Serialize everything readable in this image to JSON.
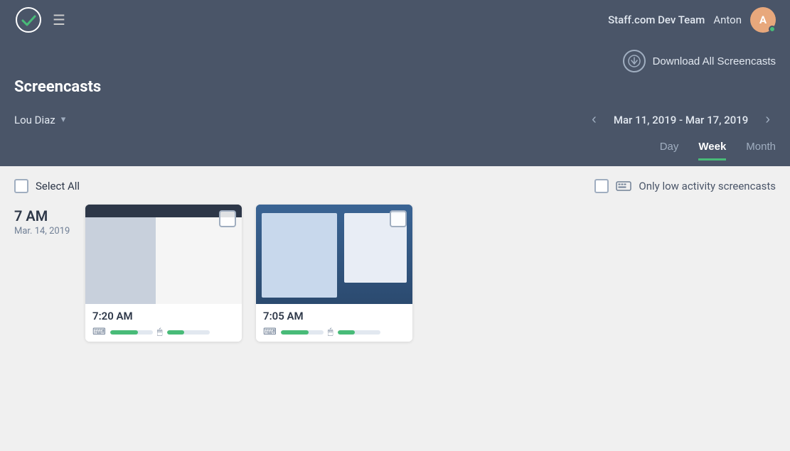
{
  "navbar": {
    "team": "Staff.com Dev Team",
    "user": "Anton",
    "avatar_initial": "A"
  },
  "header": {
    "download_label": "Download All Screencasts",
    "title": "Screencasts",
    "selected_user": "Lou Diaz",
    "date_range": "Mar 11, 2019 - Mar 17, 2019"
  },
  "view_tabs": [
    {
      "label": "Day",
      "active": false
    },
    {
      "label": "Week",
      "active": true
    },
    {
      "label": "Month",
      "active": false
    }
  ],
  "filters": {
    "select_all_label": "Select All",
    "low_activity_label": "Only low activity screencasts"
  },
  "time_block": {
    "time": "7 AM",
    "date": "Mar. 14, 2019"
  },
  "cards": [
    {
      "time": "7:20 AM"
    },
    {
      "time": "7:05 AM"
    }
  ]
}
